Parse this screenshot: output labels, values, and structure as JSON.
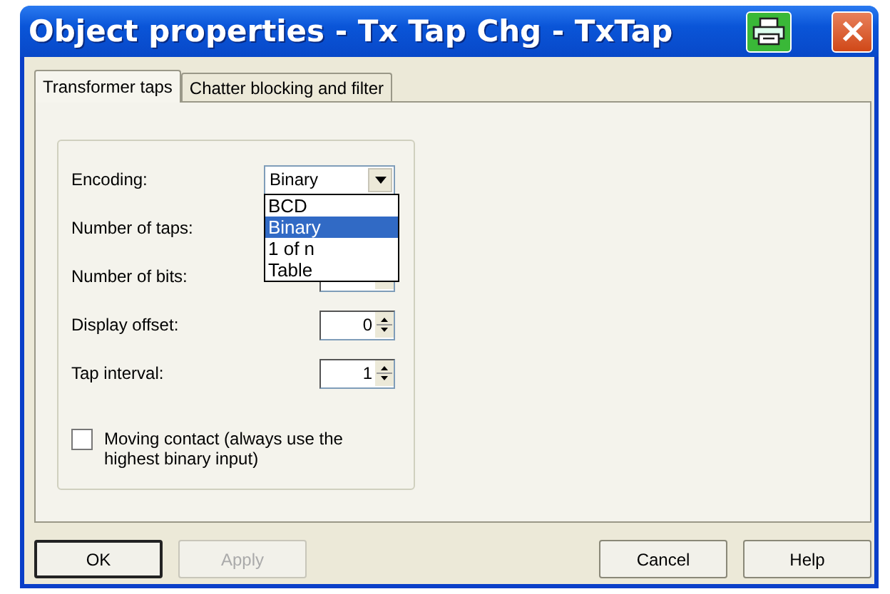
{
  "window": {
    "title": "Object properties - Tx Tap Chg - TxTap"
  },
  "tabs": [
    {
      "label": "Transformer taps",
      "selected": true
    },
    {
      "label": "Chatter blocking and filter",
      "selected": false
    }
  ],
  "fields": [
    {
      "kind": "combo",
      "label": "Encoding:",
      "value": "Binary",
      "expanded": true,
      "options": [
        {
          "label": "BCD",
          "selected": false
        },
        {
          "label": "Binary",
          "selected": true
        },
        {
          "label": "1 of n",
          "selected": false
        },
        {
          "label": "Table",
          "selected": false
        }
      ]
    },
    {
      "kind": "covered",
      "label": "Number of taps:"
    },
    {
      "kind": "spin",
      "label": "Number of bits:"
    },
    {
      "kind": "spin",
      "label": "Display offset:",
      "value": "0"
    },
    {
      "kind": "spin",
      "label": "Tap interval:",
      "value": "1"
    }
  ],
  "checkbox": {
    "label": "Moving contact (always use the highest binary input)",
    "checked": false
  },
  "buttons": [
    {
      "label": "OK",
      "default": true,
      "disabled": false
    },
    {
      "label": "Apply",
      "default": false,
      "disabled": true
    },
    {
      "label": "Cancel",
      "default": false,
      "disabled": false
    },
    {
      "label": "Help",
      "default": false,
      "disabled": false
    }
  ]
}
